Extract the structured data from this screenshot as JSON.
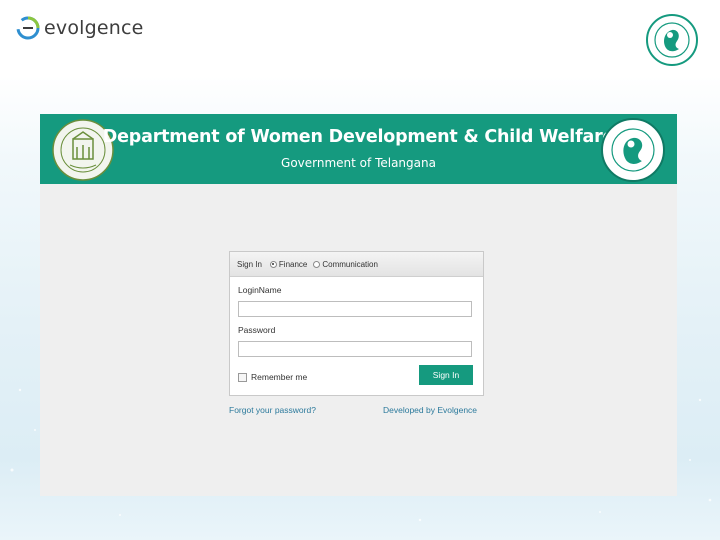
{
  "brand": {
    "name": "evolgence"
  },
  "banner": {
    "title": "Department of Women Development & Child Welfare",
    "subtitle": "Government of Telangana",
    "color": "#159a7f"
  },
  "login": {
    "tab_label": "Sign In",
    "radio_options": [
      {
        "label": "Finance",
        "selected": true
      },
      {
        "label": "Communication",
        "selected": false
      }
    ],
    "username_label": "LoginName",
    "username_value": "",
    "password_label": "Password",
    "password_value": "",
    "remember_label": "Remember me",
    "remember_checked": false,
    "submit_label": "Sign In"
  },
  "footer_links": {
    "forgot": "Forgot your password?",
    "developer": "Developed by Evolgence"
  }
}
